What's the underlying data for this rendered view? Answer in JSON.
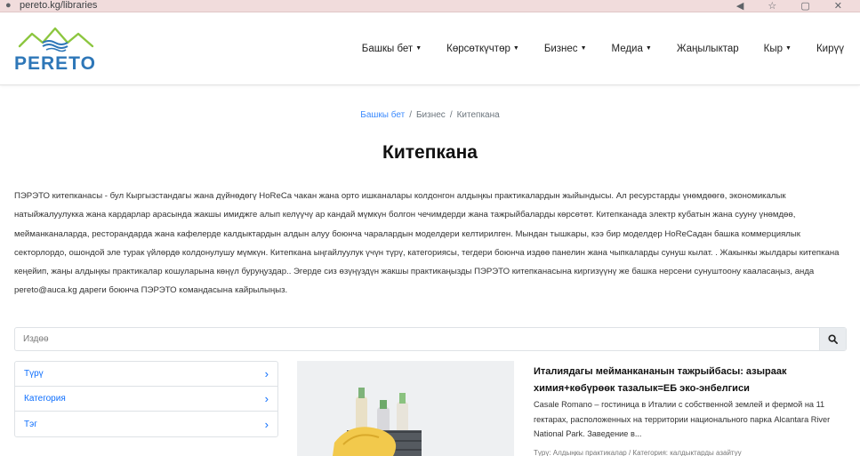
{
  "browser": {
    "url": "pereto.kg/libraries",
    "controls": "◀ ☆ ▢ ✕"
  },
  "brand": {
    "name": "PERETO",
    "color": "#2e77b8",
    "accent": "#8cc63f"
  },
  "nav": {
    "items": [
      {
        "label": "Башкы бет",
        "dropdown": true
      },
      {
        "label": "Көрсөткүчтөр",
        "dropdown": true
      },
      {
        "label": "Бизнес",
        "dropdown": true
      },
      {
        "label": "Медиа",
        "dropdown": true
      },
      {
        "label": "Жаңылыктар",
        "dropdown": false
      },
      {
        "label": "Кыр",
        "dropdown": true
      },
      {
        "label": "Кирүү",
        "dropdown": false
      }
    ],
    "caret": "▼"
  },
  "breadcrumb": {
    "home": "Башкы бет",
    "section": "Бизнес",
    "current": "Китепкана",
    "separator": "/"
  },
  "title": "Китепкана",
  "description": "ПЭРЭТО китепканасы - бул Кыргызстандагы жана дүйнөдөгү HoReCa чакан жана орто ишканалары колдонгон алдыңкы практикалардын жыйындысы. Ал ресурстарды үнөмдөөгө, экономикалык натыйжалуулукка жана кардарлар арасында жакшы имиджге алып келүүчү ар кандай мүмкүн болгон чечимдерди жана тажрыйбаларды көрсөтөт. Китепканада электр кубатын жана сууну үнөмдөө, мейманканаларда, ресторандарда жана кафелерде калдыктардын алдын алуу боюнча чаралардын моделдери келтирилген. Мындан тышкары, кээ бир моделдер HoReCадан башка коммерциялык секторлордо, ошондой эле турак үйлөрдө колдонулушу мүмкүн. Китепкана ыңгайлуулук үчүн түрү, категориясы, тегдери боюнча издөө панелин жана чыпкаларды сунуш кылат. . Жакынкы жылдары китепкана кеңейип, жаңы алдыңкы практикалар кошуларына көңүл буруңуздар.. Эгерде сиз өзүңүздүн жакшы практикаңызды ПЭРЭТО китепканасына киргизүүнү же башка нерсени сунуштоону кааласаңыз, анда pereto@auca.kg дареги боюнча ПЭРЭТО командасына кайрылыңыз.",
  "search": {
    "placeholder": "Издөө",
    "icon": "search-icon"
  },
  "filters": [
    {
      "label": "Түрү",
      "chevron": "›"
    },
    {
      "label": "Категория",
      "chevron": "›"
    },
    {
      "label": "Тэг",
      "chevron": "›"
    }
  ],
  "card": {
    "title": "Италиядагы мейманкананын тажрыйбасы: азыраак химия+көбүрөөк тазалык=ЕБ эко-энбелгиси",
    "text": "Casale Romano – гостиница в Италии с собственной землей и фермой на 11 гектарах, расположенных на территории национального парка Alcantara River National Park. Заведение в...",
    "tags": "Түрү: Алдыңкы практикалар / Категория: калдыктарды азайтуу"
  },
  "colors": {
    "link": "#0d6efd",
    "breadcrumb_link": "#3d8bfd",
    "border": "#dee2e6"
  }
}
